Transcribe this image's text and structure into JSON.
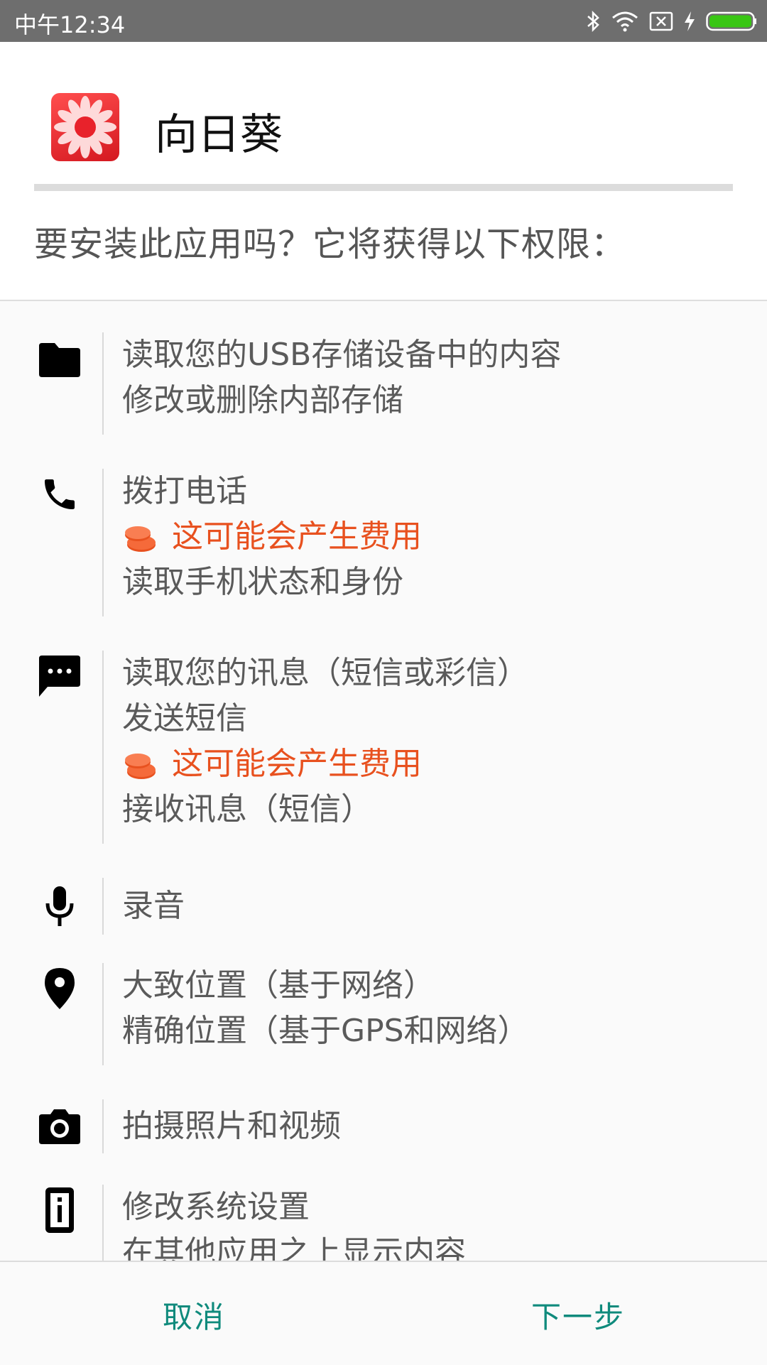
{
  "status_bar": {
    "time": "中午12:34",
    "icons": [
      "bluetooth-icon",
      "wifi-icon",
      "sim-off-icon",
      "charging-icon",
      "battery-icon"
    ],
    "battery_color": "#39c614"
  },
  "header": {
    "app_name": "向日葵",
    "install_question": "要安装此应用吗？它将获得以下权限："
  },
  "permission_groups": [
    {
      "icon": "folder-icon",
      "lines": [
        {
          "text": "读取您的USB存储设备中的内容"
        },
        {
          "text": "修改或删除内部存储"
        }
      ]
    },
    {
      "icon": "phone-icon",
      "lines": [
        {
          "text": "拨打电话"
        },
        {
          "text": "这可能会产生费用",
          "warning": true
        },
        {
          "text": "读取手机状态和身份"
        }
      ]
    },
    {
      "icon": "message-icon",
      "lines": [
        {
          "text": "读取您的讯息（短信或彩信）"
        },
        {
          "text": "发送短信"
        },
        {
          "text": "这可能会产生费用",
          "warning": true
        },
        {
          "text": "接收讯息（短信）"
        }
      ]
    },
    {
      "icon": "microphone-icon",
      "lines": [
        {
          "text": "录音"
        }
      ]
    },
    {
      "icon": "location-icon",
      "lines": [
        {
          "text": "大致位置（基于网络）"
        },
        {
          "text": "精确位置（基于GPS和网络）"
        }
      ]
    },
    {
      "icon": "camera-icon",
      "lines": [
        {
          "text": "拍摄照片和视频"
        }
      ]
    },
    {
      "icon": "settings-device-icon",
      "lines": [
        {
          "text": "修改系统设置"
        },
        {
          "text": "在其他应用之上显示内容"
        }
      ]
    }
  ],
  "buttons": {
    "cancel": "取消",
    "next": "下一步"
  },
  "colors": {
    "accent": "#0f8a7c",
    "warning": "#e8511f",
    "app_icon": "#e8222b"
  }
}
